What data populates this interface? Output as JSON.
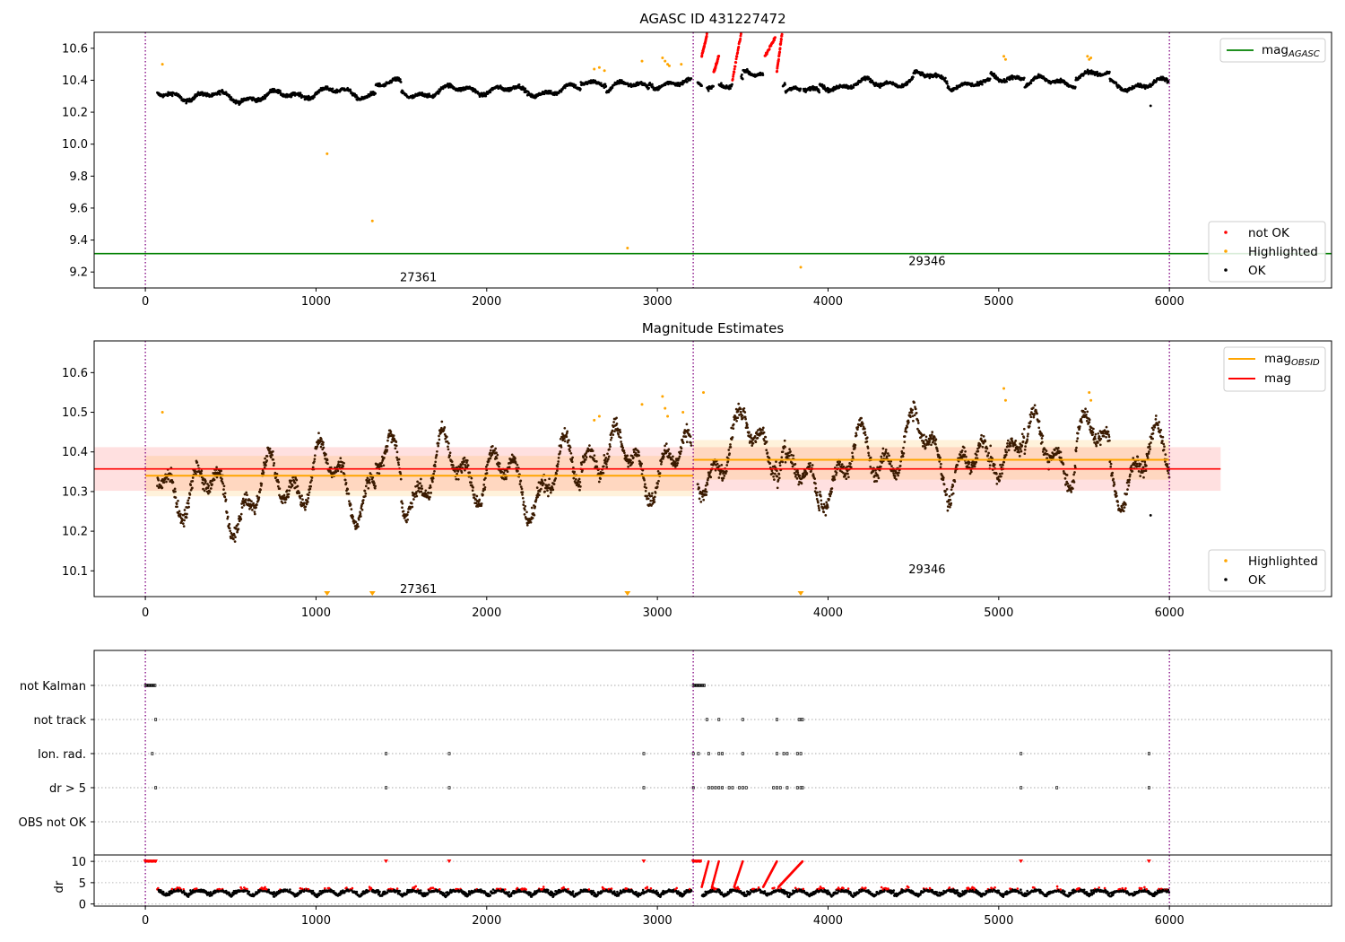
{
  "colors": {
    "ok": "#000000",
    "not_ok": "#ff0000",
    "highlighted": "#ffa500",
    "mag_agasc": "#008000",
    "mag_obsid": "#ffa500",
    "mag": "#ff0000",
    "obs_boundary": "#800080",
    "dark_orange_ok": "#3a1a00"
  },
  "chart_data": [
    {
      "type": "scatter",
      "title": "AGASC ID 431227472",
      "xlabel": "",
      "ylabel": "",
      "xlim": [
        -300,
        6950
      ],
      "ylim": [
        9.1,
        10.7
      ],
      "xticks": [
        0,
        1000,
        2000,
        3000,
        4000,
        5000,
        6000
      ],
      "yticks": [
        9.2,
        9.4,
        9.6,
        9.8,
        10.0,
        10.2,
        10.4,
        10.6
      ],
      "grid": false,
      "legend_upper": {
        "placement": "top-right",
        "entries": [
          {
            "label": "mag",
            "sub": "AGASC",
            "color": "#008000",
            "kind": "line"
          }
        ]
      },
      "legend_lower": {
        "placement": "bottom-right",
        "entries": [
          {
            "label": "not OK",
            "color": "#ff0000",
            "kind": "marker"
          },
          {
            "label": "Highlighted",
            "color": "#ffa500",
            "kind": "marker"
          },
          {
            "label": "OK",
            "color": "#000000",
            "kind": "marker"
          }
        ]
      },
      "hlines": [
        {
          "name": "mag_AGASC",
          "y": 9.315
        }
      ],
      "obs_boundaries": [
        0,
        3210,
        6000
      ],
      "obsid_labels": [
        {
          "text": "27361",
          "x": 1600,
          "y": 9.17
        },
        {
          "text": "29346",
          "x": 4580,
          "y": 9.27
        }
      ],
      "obs_segments": [
        {
          "obsid": "27361",
          "x_start": 70,
          "x_end": 3200,
          "mean": 10.32
        },
        {
          "obsid": "29346",
          "x_start": 3230,
          "x_end": 5990,
          "mean": 10.4
        }
      ],
      "highlighted_points": [
        {
          "x": 100,
          "y": 10.5
        },
        {
          "x": 1065,
          "y": 9.94
        },
        {
          "x": 1330,
          "y": 9.52
        },
        {
          "x": 2825,
          "y": 9.35
        },
        {
          "x": 3840,
          "y": 9.23
        },
        {
          "x": 2630,
          "y": 10.47
        },
        {
          "x": 2660,
          "y": 10.48
        },
        {
          "x": 2690,
          "y": 10.46
        },
        {
          "x": 2910,
          "y": 10.52
        },
        {
          "x": 3030,
          "y": 10.54
        },
        {
          "x": 3045,
          "y": 10.52
        },
        {
          "x": 3060,
          "y": 10.5
        },
        {
          "x": 3070,
          "y": 10.49
        },
        {
          "x": 3140,
          "y": 10.5
        },
        {
          "x": 5030,
          "y": 10.55
        },
        {
          "x": 5040,
          "y": 10.53
        },
        {
          "x": 5520,
          "y": 10.55
        },
        {
          "x": 5530,
          "y": 10.53
        },
        {
          "x": 5540,
          "y": 10.54
        }
      ],
      "not_ok_runs": [
        {
          "x_start": 3260,
          "x_end": 3290,
          "y_start": 10.55,
          "y_end": 10.68
        },
        {
          "x_start": 3330,
          "x_end": 3360,
          "y_start": 10.45,
          "y_end": 10.55
        },
        {
          "x_start": 3440,
          "x_end": 3490,
          "y_start": 10.4,
          "y_end": 10.69
        },
        {
          "x_start": 3630,
          "x_end": 3690,
          "y_start": 10.55,
          "y_end": 10.67
        },
        {
          "x_start": 3700,
          "x_end": 3730,
          "y_start": 10.45,
          "y_end": 10.69
        }
      ],
      "ok_outliers": [
        {
          "x": 5890,
          "y": 10.24
        }
      ]
    },
    {
      "type": "scatter",
      "title": "Magnitude Estimates",
      "xlabel": "",
      "ylabel": "",
      "xlim": [
        -300,
        6950
      ],
      "ylim": [
        10.035,
        10.68
      ],
      "xticks": [
        0,
        1000,
        2000,
        3000,
        4000,
        5000,
        6000
      ],
      "yticks": [
        10.1,
        10.2,
        10.3,
        10.4,
        10.5,
        10.6
      ],
      "grid": false,
      "legend_upper": {
        "placement": "top-right",
        "entries": [
          {
            "label": "mag",
            "sub": "OBSID",
            "color": "#ffa500",
            "kind": "line"
          },
          {
            "label": "mag",
            "sub": "",
            "color": "#ff0000",
            "kind": "line"
          }
        ]
      },
      "legend_lower": {
        "placement": "bottom-right",
        "entries": [
          {
            "label": "Highlighted",
            "color": "#ffa500",
            "kind": "marker"
          },
          {
            "label": "OK",
            "color": "#000000",
            "kind": "marker"
          }
        ]
      },
      "mag_line": {
        "y": 10.357,
        "x_start": -300,
        "x_end": 6300,
        "band_low": 10.302,
        "band_high": 10.412
      },
      "obsid_lines": [
        {
          "obsid": "27361",
          "x_start": 0,
          "x_end": 3210,
          "y": 10.34,
          "band_low": 10.288,
          "band_high": 10.39
        },
        {
          "obsid": "29346",
          "x_start": 3210,
          "x_end": 6000,
          "y": 10.38,
          "band_low": 10.33,
          "band_high": 10.43
        }
      ],
      "obs_boundaries": [
        0,
        3210,
        6000
      ],
      "obsid_labels": [
        {
          "text": "27361",
          "x": 1600,
          "y": 10.055
        },
        {
          "text": "29346",
          "x": 4580,
          "y": 10.105
        }
      ],
      "offscale_low_markers": [
        1065,
        1330,
        2825,
        3840
      ],
      "highlighted_points": [
        {
          "x": 100,
          "y": 10.5
        },
        {
          "x": 2630,
          "y": 10.48
        },
        {
          "x": 2660,
          "y": 10.49
        },
        {
          "x": 2910,
          "y": 10.52
        },
        {
          "x": 3030,
          "y": 10.54
        },
        {
          "x": 3045,
          "y": 10.51
        },
        {
          "x": 3060,
          "y": 10.49
        },
        {
          "x": 3150,
          "y": 10.5
        },
        {
          "x": 3270,
          "y": 10.55
        },
        {
          "x": 5030,
          "y": 10.56
        },
        {
          "x": 5040,
          "y": 10.53
        },
        {
          "x": 5530,
          "y": 10.55
        },
        {
          "x": 5540,
          "y": 10.53
        }
      ],
      "ok_outliers": [
        {
          "x": 5890,
          "y": 10.24
        }
      ]
    },
    {
      "type": "scatter",
      "title": "",
      "xlabel": "",
      "ylabel": "",
      "xlim": [
        -300,
        6950
      ],
      "xticks": [
        0,
        1000,
        2000,
        3000,
        4000,
        5000,
        6000
      ],
      "flag_rows": [
        "not Kalman",
        "not track",
        "Ion. rad.",
        "dr > 5",
        "OBS not OK"
      ],
      "flag_points": {
        "not Kalman": [
          {
            "x_start": 0,
            "x_end": 60
          },
          {
            "x_start": 3210,
            "x_end": 3280
          }
        ],
        "not track": [
          60,
          3290,
          3360,
          3500,
          3700,
          3830,
          3840,
          3850
        ],
        "Ion. rad.": [
          40,
          1410,
          1780,
          2920,
          3210,
          3240,
          3300,
          3360,
          3380,
          3500,
          3700,
          3740,
          3760,
          3820,
          3840,
          5130,
          5880
        ],
        "dr > 5": [
          60,
          1410,
          1780,
          2920,
          3210,
          3300,
          3320,
          3340,
          3360,
          3380,
          3420,
          3440,
          3480,
          3500,
          3520,
          3680,
          3700,
          3720,
          3760,
          3820,
          3840,
          3850,
          5130,
          5340,
          5880
        ],
        "OBS not OK": []
      },
      "dr_panel": {
        "ylabel": "dr",
        "ylim": [
          -0.5,
          11.5
        ],
        "yticks": [
          0,
          5,
          10
        ],
        "cap": 10,
        "capped_points": [
          0,
          20,
          40,
          60,
          1410,
          1780,
          2920,
          3210,
          3230,
          3250,
          5130,
          5880
        ],
        "spike_runs": [
          {
            "x_start": 3260,
            "x_end": 3300
          },
          {
            "x_start": 3320,
            "x_end": 3360
          },
          {
            "x_start": 3450,
            "x_end": 3500
          },
          {
            "x_start": 3620,
            "x_end": 3700
          },
          {
            "x_start": 3710,
            "x_end": 3850
          }
        ]
      }
    }
  ]
}
